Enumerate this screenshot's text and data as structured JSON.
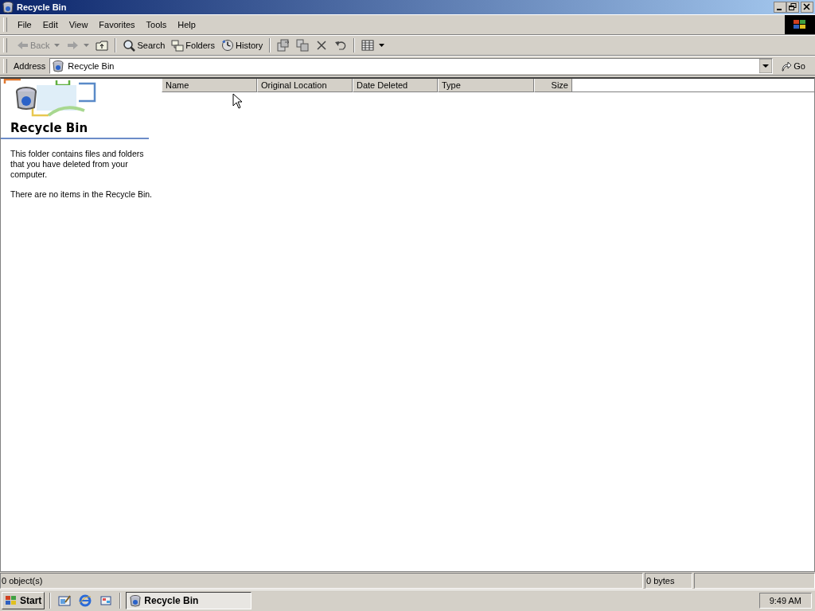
{
  "window": {
    "title": "Recycle Bin"
  },
  "menu": [
    "File",
    "Edit",
    "View",
    "Favorites",
    "Tools",
    "Help"
  ],
  "toolbar": [
    {
      "kind": "back",
      "label": "Back",
      "disabled": true,
      "dropdown": true
    },
    {
      "kind": "forward",
      "disabled": true,
      "dropdown": true
    },
    {
      "kind": "up"
    },
    {
      "kind": "separator"
    },
    {
      "kind": "search",
      "label": "Search"
    },
    {
      "kind": "folders",
      "label": "Folders"
    },
    {
      "kind": "history",
      "label": "History"
    },
    {
      "kind": "separator"
    },
    {
      "kind": "move"
    },
    {
      "kind": "copy"
    },
    {
      "kind": "delete"
    },
    {
      "kind": "undo"
    },
    {
      "kind": "separator"
    },
    {
      "kind": "views",
      "dropdown": true
    }
  ],
  "address": {
    "label": "Address",
    "value": "Recycle Bin",
    "go": "Go"
  },
  "sidebar": {
    "title": "Recycle Bin",
    "paragraphs": [
      "This folder contains files and folders that you have deleted from your computer.",
      "There are no items in the Recycle Bin."
    ]
  },
  "columns": [
    "Name",
    "Original Location",
    "Date Deleted",
    "Type",
    "Size"
  ],
  "status_bar": [
    "0 object(s)",
    "0 bytes"
  ],
  "taskbar": {
    "start": "Start",
    "tasks": [
      {
        "label": "Recycle Bin",
        "selected": true
      }
    ],
    "clock": "9:49 AM"
  }
}
